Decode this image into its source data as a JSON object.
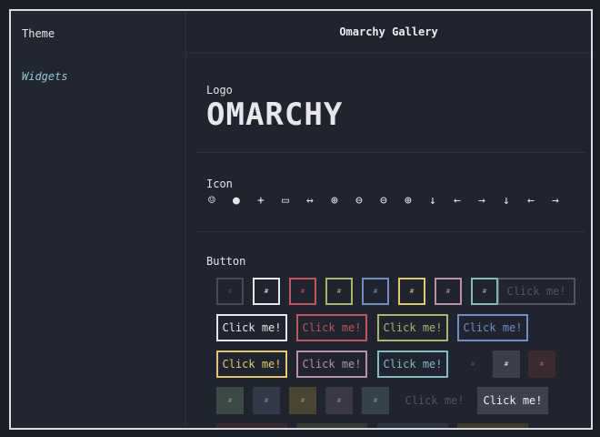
{
  "sidebar": {
    "theme_label": "Theme",
    "widgets_label": "Widgets"
  },
  "header": {
    "title": "Omarchy Gallery"
  },
  "sections": {
    "logo": "Logo",
    "icon": "Icon",
    "button": "Button"
  },
  "logo_text": "OMARCHY",
  "icons": [
    {
      "name": "user-circle-icon",
      "glyph": "☺"
    },
    {
      "name": "toggle-icon",
      "glyph": "●"
    },
    {
      "name": "plus-icon",
      "glyph": "+"
    },
    {
      "name": "archive-icon",
      "glyph": "▭"
    },
    {
      "name": "arrows-horizontal-icon",
      "glyph": "↔"
    },
    {
      "name": "circle-arrow-down-icon",
      "glyph": "⊕"
    },
    {
      "name": "circle-arrow-left-icon",
      "glyph": "⊖"
    },
    {
      "name": "circle-arrow-right-icon",
      "glyph": "⊖"
    },
    {
      "name": "circle-arrow-up-icon",
      "glyph": "⊕"
    },
    {
      "name": "arrow-down-icon",
      "glyph": "↓"
    },
    {
      "name": "arrow-left-icon",
      "glyph": "←"
    },
    {
      "name": "arrow-right-icon",
      "glyph": "→"
    },
    {
      "name": "small-arrow-down-icon",
      "glyph": "↓"
    },
    {
      "name": "small-arrow-left-icon",
      "glyph": "←"
    },
    {
      "name": "small-arrow-right-icon",
      "glyph": "→"
    }
  ],
  "button_label": "Click me!",
  "icon_button_label": "#",
  "colors": {
    "white": "#e6e6ea",
    "red": "#c4525f",
    "green": "#a6b56a",
    "blue": "#6e8fc0",
    "yellow": "#e3c96a",
    "pink": "#b98fa7",
    "cyan": "#7dbdc2",
    "accent": "#8fc7d6",
    "gray": "#8b909c"
  }
}
